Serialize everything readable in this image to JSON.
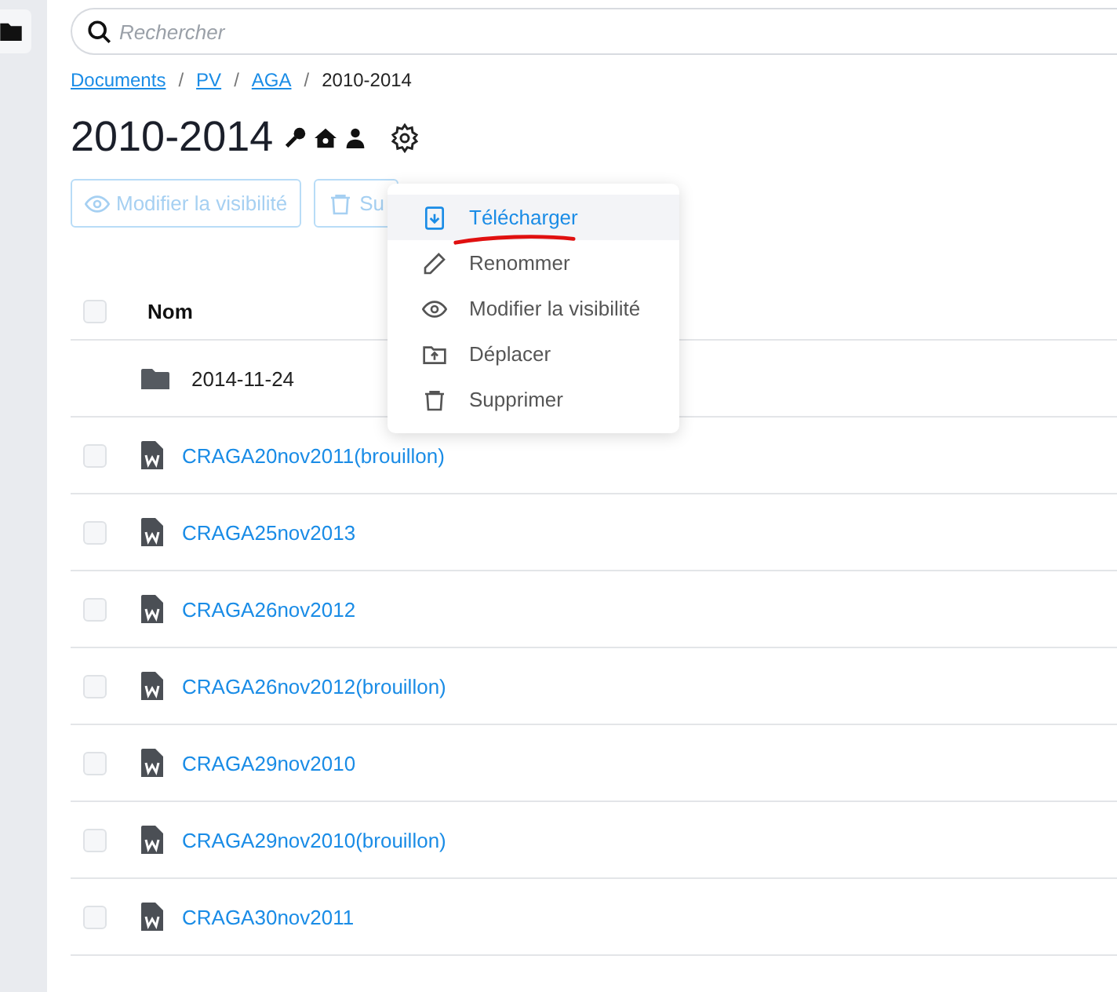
{
  "search": {
    "placeholder": "Rechercher"
  },
  "breadcrumb": [
    {
      "label": "Documents",
      "kind": "link"
    },
    {
      "label": "PV",
      "kind": "link"
    },
    {
      "label": "AGA",
      "kind": "link"
    },
    {
      "label": "2010-2014",
      "kind": "current"
    }
  ],
  "separator": "/",
  "title": "2010-2014",
  "toolbar": [
    {
      "label": "Modifier la visibilité",
      "kind": "eye",
      "disabled": true
    },
    {
      "label": "Su",
      "kind": "trash",
      "disabled": true
    }
  ],
  "menu": [
    {
      "label": "Télécharger",
      "kind": "download",
      "selected": true,
      "annotated": true
    },
    {
      "label": "Renommer",
      "kind": "pencil",
      "selected": false,
      "annotated": false
    },
    {
      "label": "Modifier la visibilité",
      "kind": "eye",
      "selected": false,
      "annotated": false
    },
    {
      "label": "Déplacer",
      "kind": "move",
      "selected": false,
      "annotated": false
    },
    {
      "label": "Supprimer",
      "kind": "trash",
      "selected": false,
      "annotated": false
    }
  ],
  "table": {
    "header": {
      "label": "Nom",
      "checked": false
    },
    "rows": [
      {
        "kind": "folder",
        "name": "2014-11-24"
      },
      {
        "kind": "file",
        "name": "CRAGA20nov2011(brouillon)",
        "checked": false
      },
      {
        "kind": "file",
        "name": "CRAGA25nov2013",
        "checked": false
      },
      {
        "kind": "file",
        "name": "CRAGA26nov2012",
        "checked": false
      },
      {
        "kind": "file",
        "name": "CRAGA26nov2012(brouillon)",
        "checked": false
      },
      {
        "kind": "file",
        "name": "CRAGA29nov2010",
        "checked": false
      },
      {
        "kind": "file",
        "name": "CRAGA29nov2010(brouillon)",
        "checked": false
      },
      {
        "kind": "file",
        "name": "CRAGA30nov2011",
        "checked": false
      }
    ]
  }
}
